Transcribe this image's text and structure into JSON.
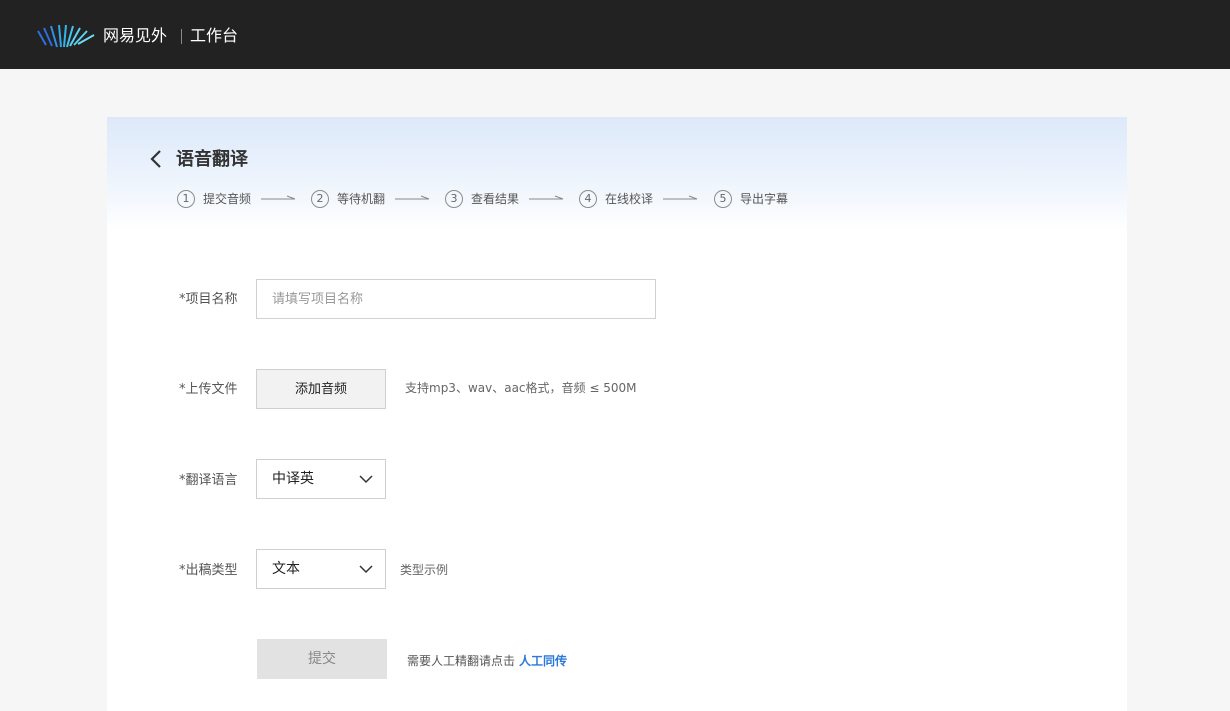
{
  "header": {
    "brand": "网易见外",
    "workspace": "工作台",
    "logo_icon": "wave-stripes-logo",
    "logo_colors": [
      "#2d6fe0",
      "#2fa7e8",
      "#5cd0f0"
    ]
  },
  "page": {
    "title": "语音翻译",
    "back_icon": "chevron-left-icon"
  },
  "steps": [
    {
      "number": "1",
      "label": "提交音频"
    },
    {
      "number": "2",
      "label": "等待机翻"
    },
    {
      "number": "3",
      "label": "查看结果"
    },
    {
      "number": "4",
      "label": "在线校译"
    },
    {
      "number": "5",
      "label": "导出字幕"
    }
  ],
  "form": {
    "project_name": {
      "label": "*项目名称",
      "value": "",
      "placeholder": "请填写项目名称"
    },
    "upload": {
      "label": "*上传文件",
      "button": "添加音频",
      "hint": "支持mp3、wav、aac格式，音频 ≤ 500M"
    },
    "language": {
      "label": "*翻译语言",
      "selected": "中译英"
    },
    "output_type": {
      "label": "*出稿类型",
      "selected": "文本",
      "example_link": "类型示例"
    },
    "submit": {
      "button": "提交",
      "manual_text": "需要人工精翻请点击",
      "manual_link": "人工同传"
    }
  },
  "colors": {
    "topbar": "#222222",
    "link": "#2b7ad9",
    "submit_disabled_bg": "#e2e2e2"
  }
}
